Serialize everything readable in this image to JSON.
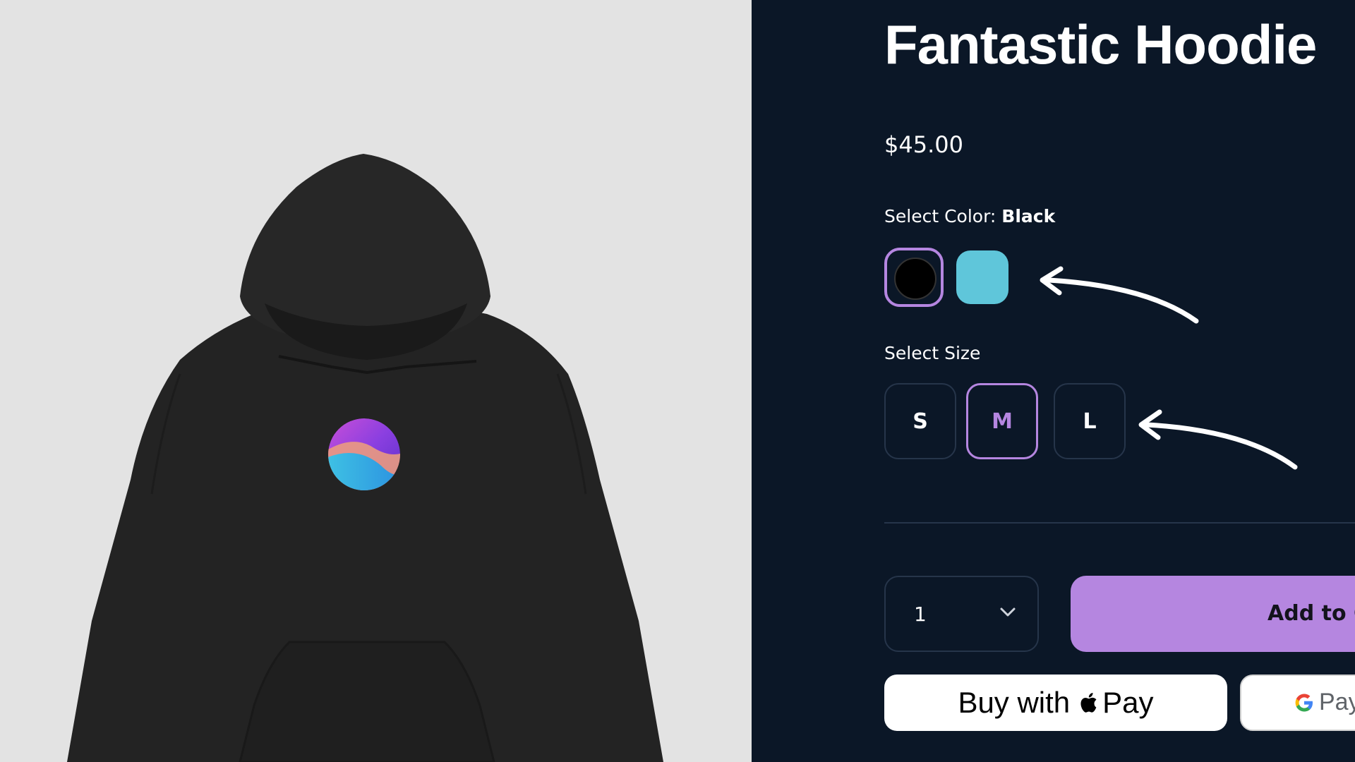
{
  "product": {
    "title": "Fantastic Hoodie",
    "price": "$45.00"
  },
  "color": {
    "label": "Select Color:",
    "selected": "Black",
    "options": [
      {
        "name": "Black",
        "hex": "#000000",
        "selected": true
      },
      {
        "name": "Light Blue",
        "hex": "#5fc6da",
        "selected": false
      }
    ]
  },
  "size": {
    "label": "Select Size",
    "options": [
      {
        "label": "S",
        "selected": false
      },
      {
        "label": "M",
        "selected": true
      },
      {
        "label": "L",
        "selected": false
      }
    ]
  },
  "quantity": {
    "value": "1"
  },
  "cart": {
    "label": "Add to C"
  },
  "apple_pay": {
    "prefix": "Buy with",
    "suffix": "Pay"
  },
  "google_pay": {
    "suffix": "Pay"
  },
  "colors": {
    "panel_bg": "#0b1727",
    "accent": "#b586e0",
    "image_bg": "#e3e3e3"
  }
}
